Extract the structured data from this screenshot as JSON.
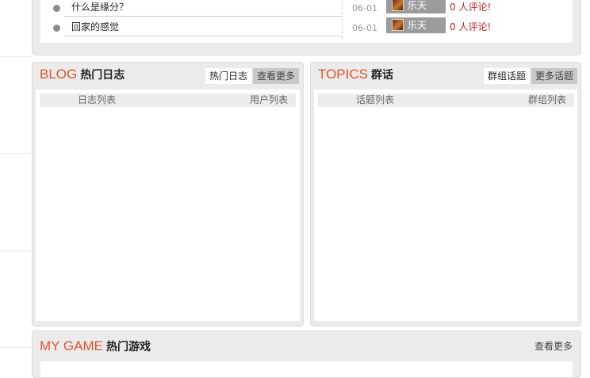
{
  "posts": [
    {
      "title": "什么是缘分？",
      "date": "06-01",
      "user": "乐天",
      "comments": "0 人评论!"
    },
    {
      "title": "回家的感觉",
      "date": "06-01",
      "user": "乐天",
      "comments": "0 人评论!"
    }
  ],
  "blog": {
    "title_en": "BLOG",
    "title_zh": "热门日志",
    "tabs": [
      "热门日志",
      "查看更多"
    ],
    "list_left": "日志列表",
    "list_right": "用户列表"
  },
  "topics": {
    "title_en": "TOPICS",
    "title_zh": "群话",
    "tabs": [
      "群组话题",
      "更多话题"
    ],
    "list_left": "话题列表",
    "list_right": "群组列表"
  },
  "game": {
    "title_en": "MY GAME",
    "title_zh": "热门游戏",
    "more": "查看更多"
  }
}
